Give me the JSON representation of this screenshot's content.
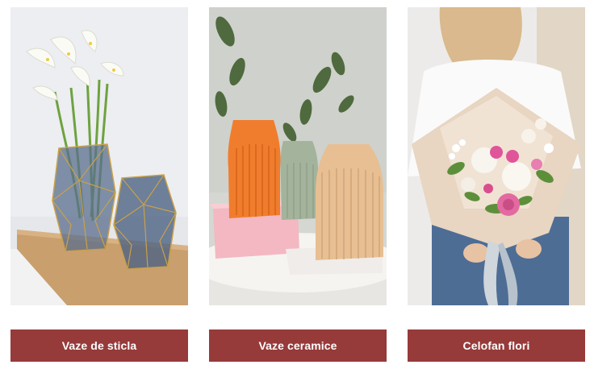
{
  "categories": [
    {
      "label": "Vaze de sticla",
      "image": "glass-vases-with-calla-lilies"
    },
    {
      "label": "Vaze ceramice",
      "image": "ceramic-vases-orange-sage-beige"
    },
    {
      "label": "Celofan flori",
      "image": "woman-holding-wrapped-bouquet"
    }
  ],
  "colors": {
    "button_bg": "#973a3a",
    "button_text": "#ffffff",
    "page_bg": "#ffffff"
  }
}
